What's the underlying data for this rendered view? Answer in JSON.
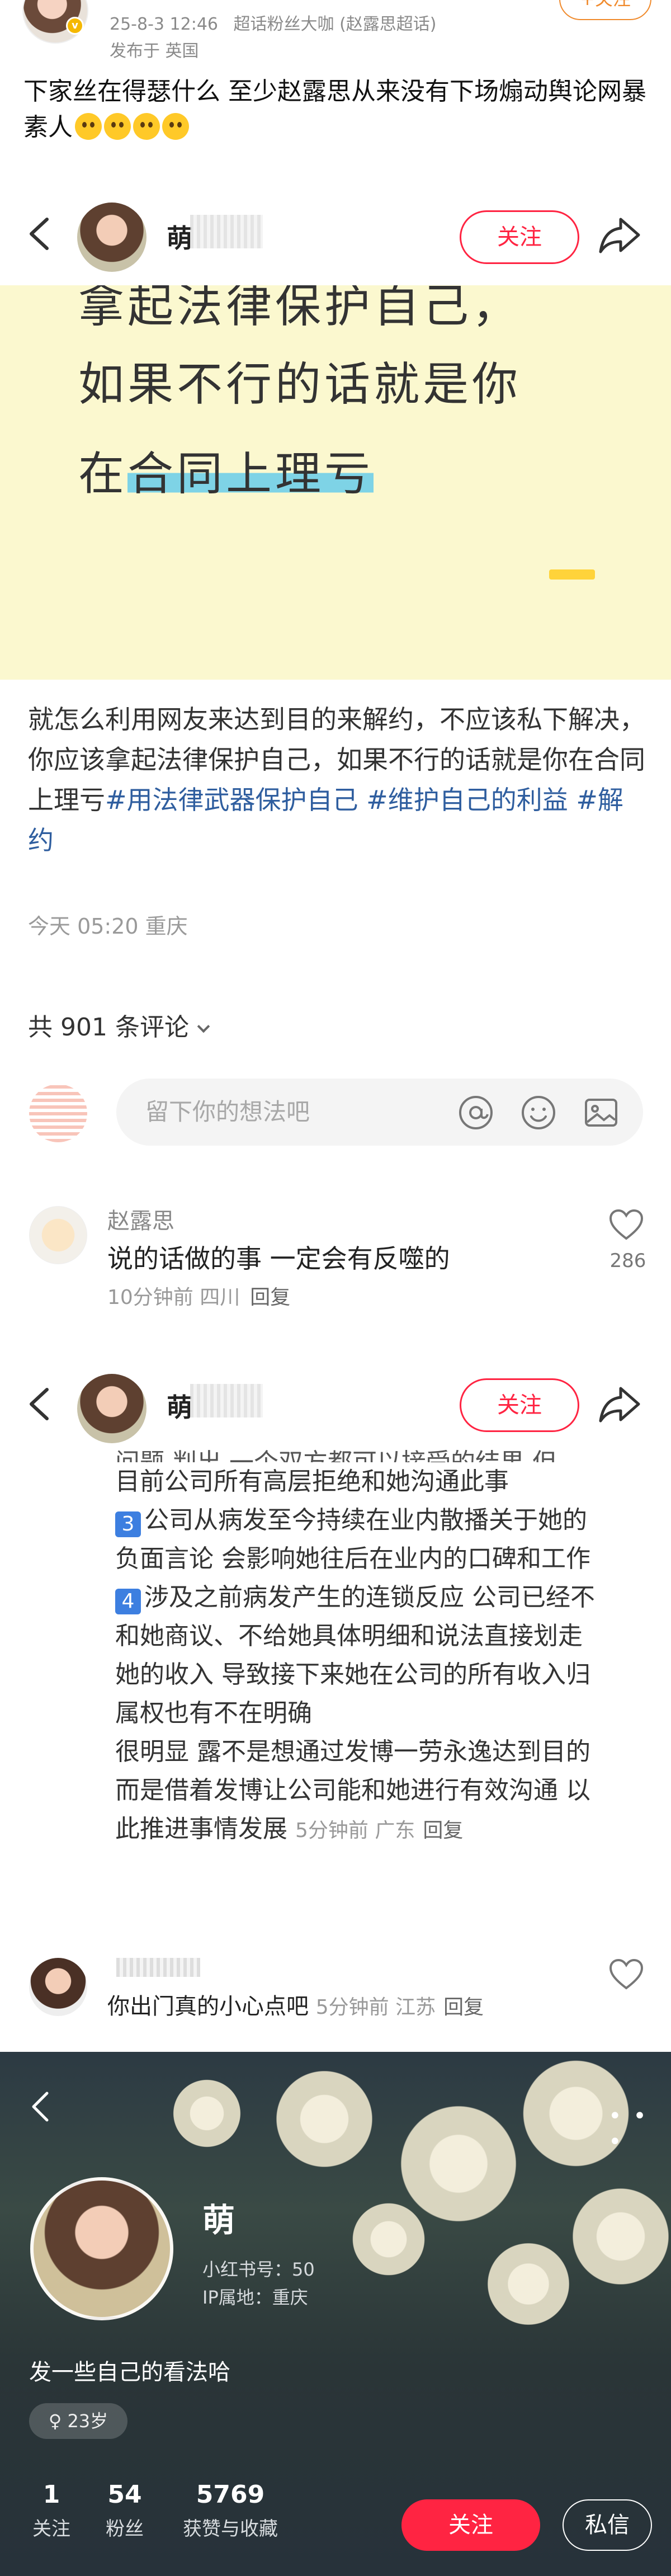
{
  "post": {
    "time": "25-8-3 12:46",
    "badge": "超话粉丝大咖 (赵露思超话)",
    "location": "发布于 英国",
    "follow": "+关注",
    "text": "下家丝在得瑟什么 至少赵露思从来没有下场煽动舆论网暴素人"
  },
  "note": {
    "nav_name": "萌",
    "follow": "关注",
    "image_line_cut": "拿起法律保护自己，",
    "image_line_2": "如果不行的话就是你",
    "image_line_3_pre": "在",
    "image_line_3_hl": "合同上理亏",
    "body_text": "就怎么利用网友来达到目的来解约，不应该私下解决，你应该拿起法律保护自己，如果不行的话就是你在合同上理亏",
    "tags": [
      "#用法律武器保护自己",
      "#维护自己的利益",
      "#解约"
    ],
    "time": "今天 05:20 重庆",
    "comment_count": "共 901 条评论",
    "input_placeholder": "留下你的想法吧",
    "comment1": {
      "name": "赵露思",
      "text": "说的话做的事 一定会有反噬的",
      "meta": "10分钟前 四川",
      "reply": "回复",
      "likes": "286"
    }
  },
  "shot2": {
    "nav_name": "萌",
    "follow": "关注",
    "cut_line": "问题 判出 一个双方都可以接受的结果 但",
    "line_a": "目前公司所有高层拒绝和她沟通此事",
    "item3_num": "3",
    "item3": "公司从病发至今持续在业内散播关于她的负面言论 会影响她往后在业内的口碑和工作",
    "item4_num": "4",
    "item4": "涉及之前病发产生的连锁反应 公司已经不和她商议、不给她具体明细和说法直接划走她的收入 导致接下来她在公司的所有收入归属权也有不在明确",
    "conclusion": "很明显 露不是想通过发博一劳永逸达到目的 而是借着发博让公司能和她进行有效沟通 以此推进事情发展",
    "reply_meta": "5分钟前 广东",
    "reply": "回复",
    "comment2": {
      "text": "你出门真的小心点吧",
      "meta": "5分钟前 江苏",
      "reply": "回复"
    }
  },
  "profile": {
    "more": "• • •",
    "name": "萌",
    "id_label": "小红书号：50",
    "ip_label": "IP属地：重庆",
    "bio": "发一些自己的看法哈",
    "age": "♀ 23岁",
    "stats": [
      {
        "n": "1",
        "l": "关注"
      },
      {
        "n": "54",
        "l": "粉丝"
      },
      {
        "n": "5769",
        "l": "获赞与收藏"
      }
    ],
    "follow": "关注",
    "message": "私信"
  },
  "colors": {
    "brand_red": "#ff2442",
    "tag_blue": "#2f5e9f",
    "highlight": "#7ed3e6",
    "note_bg": "#fbf8cf"
  }
}
